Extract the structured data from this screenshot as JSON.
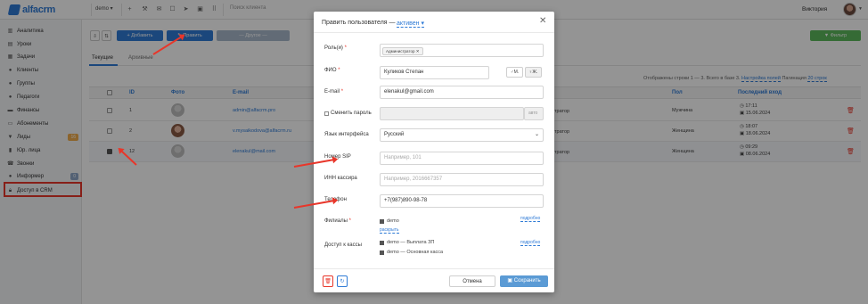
{
  "topbar": {
    "logo": "alfacrm",
    "branch": "demo",
    "search_placeholder": "Поиск клиента",
    "user_name": "Виктория",
    "icons": [
      "plus-icon",
      "wrench-icon",
      "mail-icon",
      "phone-icon",
      "telegram-icon",
      "cart-icon",
      "grid-icon"
    ]
  },
  "sidebar": {
    "items": [
      {
        "label": "Аналитика",
        "icon": "chart-icon"
      },
      {
        "label": "Уроки",
        "icon": "lessons-icon"
      },
      {
        "label": "Задачи",
        "icon": "tasks-icon"
      },
      {
        "label": "Клиенты",
        "icon": "user-icon"
      },
      {
        "label": "Группы",
        "icon": "group-icon"
      },
      {
        "label": "Педагоги",
        "icon": "teacher-icon"
      },
      {
        "label": "Финансы",
        "icon": "money-icon"
      },
      {
        "label": "Абонементы",
        "icon": "ticket-icon"
      },
      {
        "label": "Лиды",
        "icon": "funnel-icon",
        "badge": "16"
      },
      {
        "label": "Юр. лица",
        "icon": "building-icon"
      },
      {
        "label": "Звонки",
        "icon": "call-icon"
      },
      {
        "label": "Информер",
        "icon": "info-icon",
        "badge": "0"
      },
      {
        "label": "Доступ в CRM",
        "icon": "lock-icon"
      }
    ],
    "colors": {
      "badge_orange": "#f0ad4e",
      "badge_blue": "#8fa8c8",
      "highlight": "#e8362a"
    }
  },
  "toolbar": {
    "add_label": "+ Добавить",
    "edit_label": "✎ Править",
    "more_label": "— Другое —",
    "filter_label": "▼ Фильтр"
  },
  "tabs": [
    {
      "label": "Текущие"
    },
    {
      "label": "Архивные"
    }
  ],
  "table_meta": {
    "shown": "Отображены строки 1 — 3. Всего в базе 3.",
    "fields_link": "Настройка полей",
    "pagination_label": "Пагинация",
    "pagination_value": "20 строк"
  },
  "table": {
    "columns": [
      "ID",
      "Фото",
      "E-mail",
      "Пол",
      "Последний вход"
    ],
    "rows": [
      {
        "id": "1",
        "email": "admin@alfacrm.pro",
        "role_tail": "тратор",
        "gender": "Мужчина",
        "last_time": "17:11",
        "last_date": "15.06.2024",
        "checked": false
      },
      {
        "id": "2",
        "email": "v.mysaikodova@alfacrm.ru",
        "role_tail": "тратор",
        "gender": "Женщина",
        "last_time": "18:07",
        "last_date": "18.06.2024",
        "checked": false
      },
      {
        "id": "12",
        "email": "elenakul@mail.com",
        "role_tail": "тратор",
        "gender": "Женщина",
        "last_time": "09:29",
        "last_date": "08.06.2024",
        "checked": true
      }
    ]
  },
  "modal": {
    "title": "Править пользователя",
    "dash": "—",
    "status": "активен",
    "labels": {
      "roles": "Роль(и)",
      "fio": "ФИО",
      "email": "E-mail",
      "change_password": "Сменить пароль",
      "language": "Язык интерфейса",
      "sip": "Номер SIP",
      "inn": "ИНН кассира",
      "phone": "Телефон",
      "branches": "Филиалы",
      "cash_access": "Доступ к кассы"
    },
    "role_tag": "Администратор",
    "fio_value": "Куликов Степан",
    "gender_m": "М.",
    "gender_f": "Ж.",
    "email_value": "elenakul@gmail.com",
    "password_hint": "авто",
    "language_value": "Русский",
    "sip_placeholder": "Например, 101",
    "inn_placeholder": "Например, 2016667357",
    "phone_value": "+7(987)890-98-78",
    "branch_option": "demo",
    "expand_link": "раскрыть",
    "details_link": "подробно",
    "cash_options": [
      "demo — Выплата ЗП",
      "demo — Основная касса"
    ],
    "cancel_label": "Отмена",
    "save_label": "Сохранить"
  },
  "colors": {
    "primary": "#2f7bd6",
    "green": "#5cb85c",
    "red": "#e8362a",
    "save_btn": "#5b9bd5"
  }
}
